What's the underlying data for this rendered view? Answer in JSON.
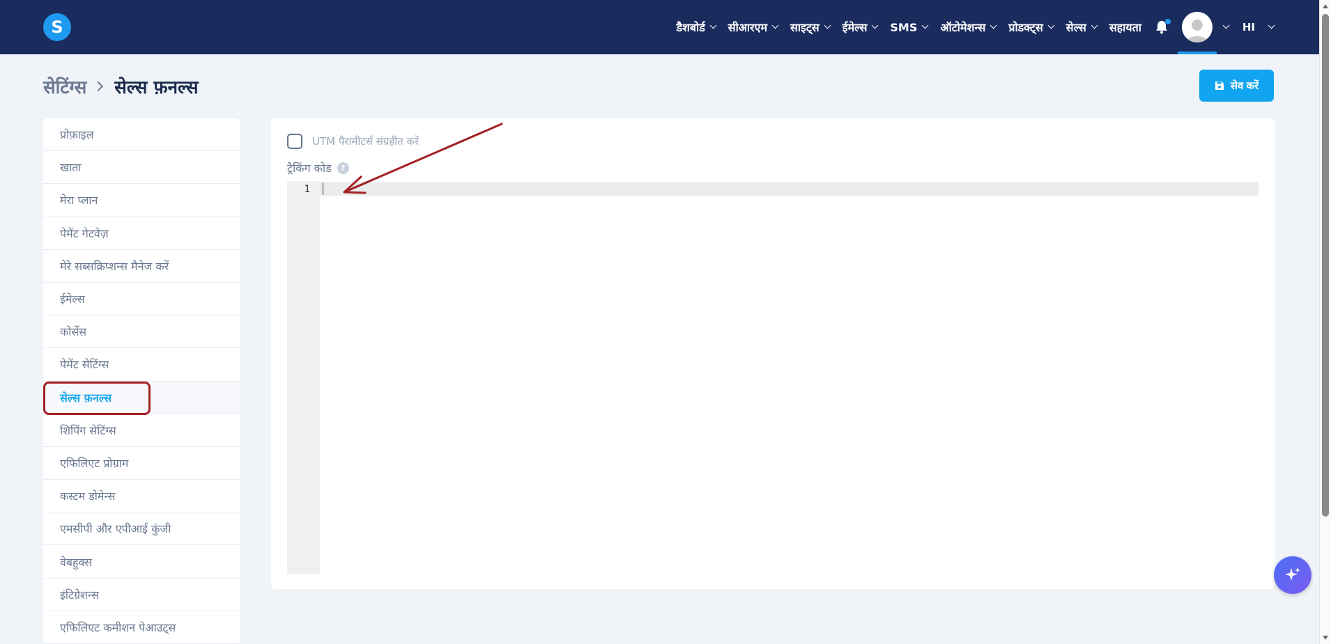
{
  "header": {
    "logo_letter": "S",
    "nav_items": [
      {
        "label": "डैशबोर्ड",
        "has_dropdown": true
      },
      {
        "label": "सीआरएम",
        "has_dropdown": true
      },
      {
        "label": "साइट्स",
        "has_dropdown": true
      },
      {
        "label": "ईमेल्स",
        "has_dropdown": true
      },
      {
        "label": "SMS",
        "has_dropdown": true
      },
      {
        "label": "ऑटोमेशन्स",
        "has_dropdown": true
      },
      {
        "label": "प्रोडक्ट्स",
        "has_dropdown": true
      },
      {
        "label": "सेल्स",
        "has_dropdown": true
      },
      {
        "label": "सहायता",
        "has_dropdown": false
      }
    ],
    "notification_icon": "bell-icon",
    "language": "HI"
  },
  "page": {
    "breadcrumb_parent": "सेटिंग्स",
    "breadcrumb_current": "सेल्स फ़नल्स",
    "save_label": "सेव करें"
  },
  "sidebar": {
    "items": [
      {
        "label": "प्रोफ़ाइल",
        "active": false
      },
      {
        "label": "खाता",
        "active": false
      },
      {
        "label": "मेरा प्लान",
        "active": false
      },
      {
        "label": "पेमेंट गेटवेज़",
        "active": false
      },
      {
        "label": "मेरे सब्सक्रिप्शन्स मैनेज करें",
        "active": false
      },
      {
        "label": "ईमेल्स",
        "active": false
      },
      {
        "label": "कोर्सेस",
        "active": false
      },
      {
        "label": "पेमेंट सेटिंग्स",
        "active": false
      },
      {
        "label": "सेल्स फ़नल्स",
        "active": true
      },
      {
        "label": "शिपिंग सेटिंग्स",
        "active": false
      },
      {
        "label": "एफिलिएट प्रोग्राम",
        "active": false
      },
      {
        "label": "कस्टम डोमेन्स",
        "active": false
      },
      {
        "label": "एमसीपी और एपीआई कुंजी",
        "active": false
      },
      {
        "label": "वेबहुक्स",
        "active": false
      },
      {
        "label": "इंटिग्रेशन्स",
        "active": false
      },
      {
        "label": "एफिलिएट कमीशन पेआउट्स",
        "active": false
      }
    ]
  },
  "main": {
    "utm_checkbox_label": "UTM पैरामीटर्स संग्रहीत करें",
    "utm_checked": false,
    "tracking_code_label": "ट्रैकिंग कोड",
    "help_glyph": "?",
    "editor": {
      "line_numbers": [
        "1"
      ],
      "content": ""
    }
  },
  "colors": {
    "navbar": "#1a2b5e",
    "accent": "#11a4f0",
    "annotation": "#a32024",
    "fab_gradient_start": "#4b6ef5",
    "fab_gradient_end": "#7b5cf0"
  }
}
